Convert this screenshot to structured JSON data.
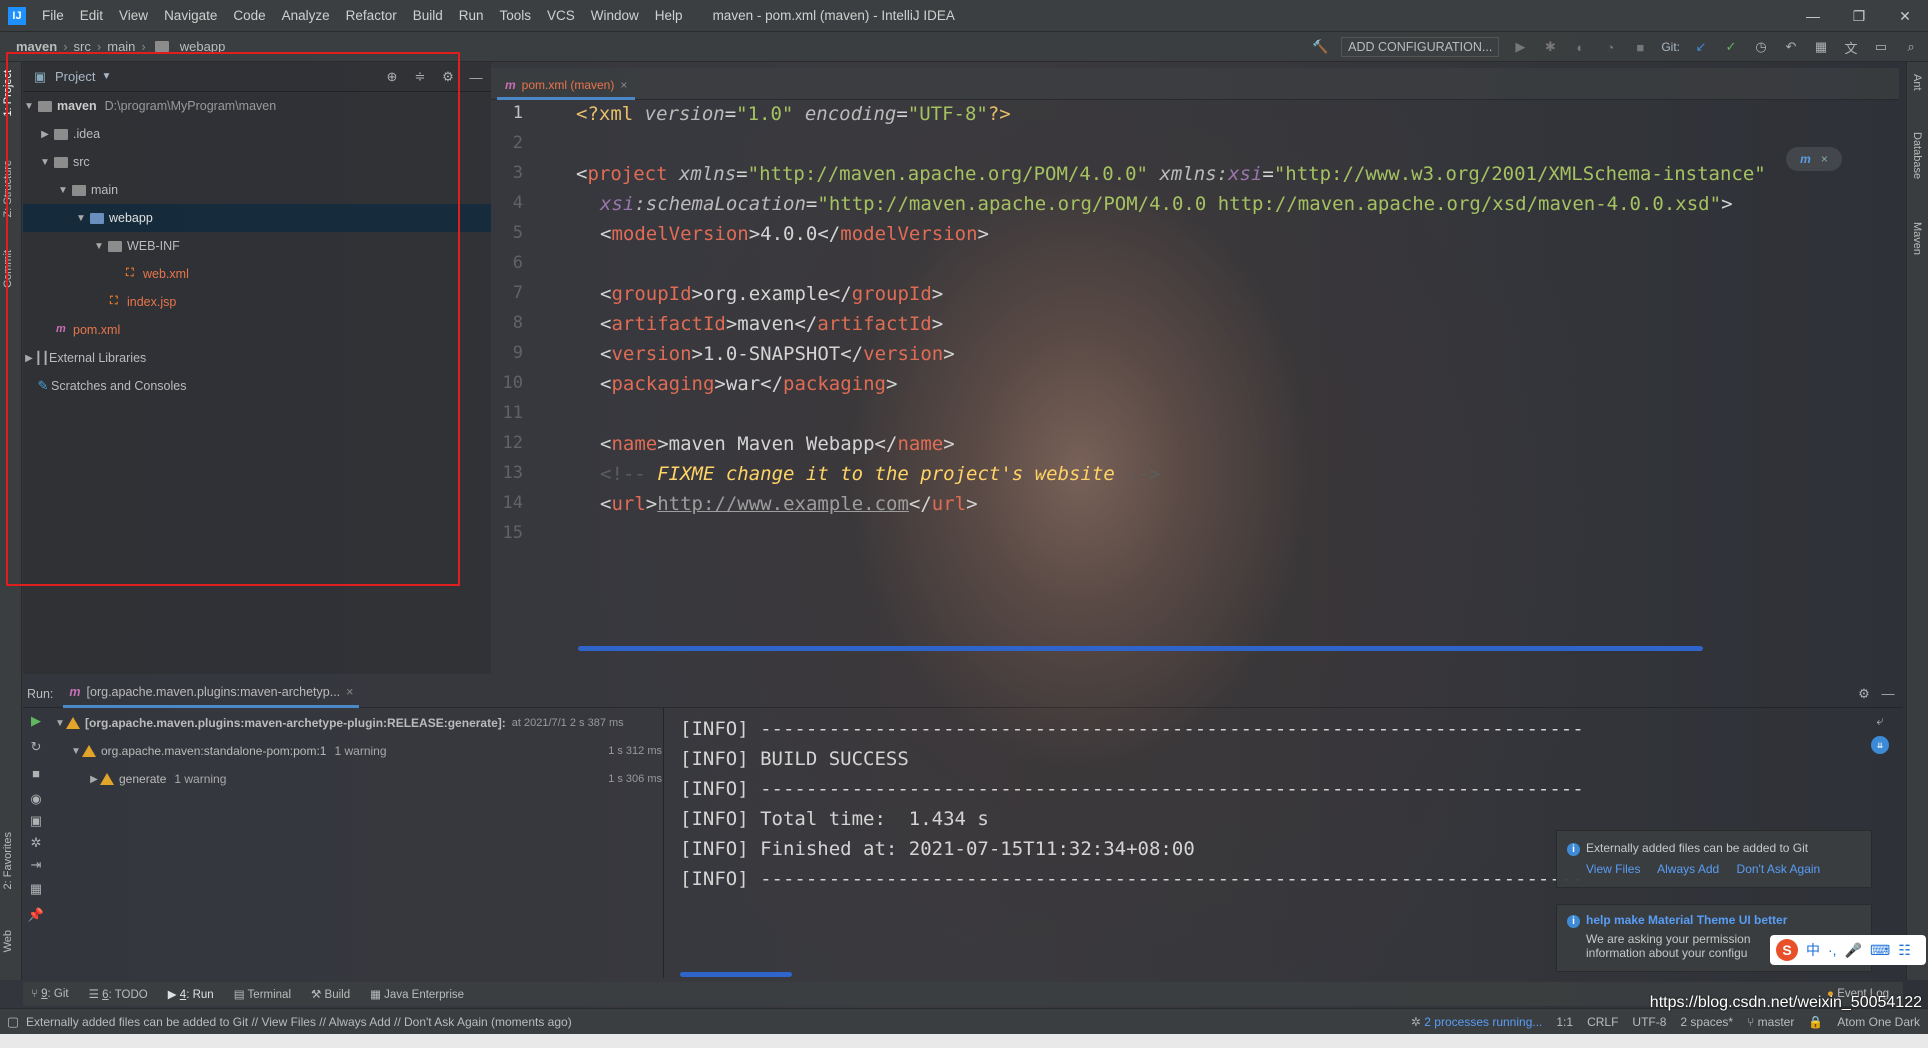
{
  "window": {
    "app_icon": "IJ",
    "menu": [
      "File",
      "Edit",
      "View",
      "Navigate",
      "Code",
      "Analyze",
      "Refactor",
      "Build",
      "Run",
      "Tools",
      "VCS",
      "Window",
      "Help"
    ],
    "title": "maven - pom.xml (maven) - IntelliJ IDEA"
  },
  "breadcrumbs": [
    "maven",
    "src",
    "main",
    "webapp"
  ],
  "toolbar": {
    "add_config": "ADD CONFIGURATION...",
    "git_label": "Git:"
  },
  "left_stripe": {
    "project": "1: Project",
    "structure": "Z: Structure",
    "commit": "Commit",
    "favorites": "2: Favorites",
    "web": "Web"
  },
  "right_stripe": {
    "ant": "Ant",
    "database": "Database",
    "maven": "Maven"
  },
  "project_panel": {
    "title": "Project",
    "tree": [
      {
        "label": "maven",
        "extra": "D:\\program\\MyProgram\\maven"
      },
      {
        "label": ".idea"
      },
      {
        "label": "src"
      },
      {
        "label": "main"
      },
      {
        "label": "webapp"
      },
      {
        "label": "WEB-INF"
      },
      {
        "label": "web.xml"
      },
      {
        "label": "index.jsp"
      },
      {
        "label": "pom.xml"
      },
      {
        "label": "External Libraries"
      },
      {
        "label": "Scratches and Consoles"
      }
    ]
  },
  "editor": {
    "tab": "pom.xml (maven)",
    "line_numbers": [
      "1",
      "2",
      "3",
      "4",
      "5",
      "6",
      "7",
      "8",
      "9",
      "10",
      "11",
      "12",
      "13",
      "14",
      "15"
    ],
    "lines": {
      "l1a": "<?xml ",
      "l1b": "version",
      "l1c": "=",
      "l1d": "\"1.0\"",
      "l1e": " encoding",
      "l1f": "=",
      "l1g": "\"UTF-8\"",
      "l1h": "?>",
      "l3a": "<",
      "l3b": "project ",
      "l3c": "xmlns",
      "l3d": "=",
      "l3e": "\"http://maven.apache.org/POM/4.0.0\"",
      "l3f": " xmlns:",
      "l3g": "xsi",
      "l3h": "=",
      "l3i": "\"http://www.w3.org/2001/XMLSchema-instance\"",
      "l4a": "xsi",
      "l4b": ":schemaLocation",
      "l4c": "=",
      "l4d": "\"http://maven.apache.org/POM/4.0.0 http://maven.apache.org/xsd/maven-4.0.0.xsd\"",
      "l4e": ">",
      "l5a": "<",
      "l5b": "modelVersion",
      "l5c": ">4.0.0</",
      "l5d": "modelVersion",
      "l5e": ">",
      "l7a": "<",
      "l7b": "groupId",
      "l7c": ">org.example</",
      "l7d": "groupId",
      "l7e": ">",
      "l8a": "<",
      "l8b": "artifactId",
      "l8c": ">maven</",
      "l8d": "artifactId",
      "l8e": ">",
      "l9a": "<",
      "l9b": "version",
      "l9c": ">1.0-SNAPSHOT</",
      "l9d": "version",
      "l9e": ">",
      "l10a": "<",
      "l10b": "packaging",
      "l10c": ">war</",
      "l10d": "packaging",
      "l10e": ">",
      "l12a": "<",
      "l12b": "name",
      "l12c": ">maven Maven Webapp</",
      "l12d": "name",
      "l12e": ">",
      "l13a": "<!-- ",
      "l13b": "FIXME change it to the project's website",
      "l13c": " -->",
      "l14a": "<",
      "l14b": "url",
      "l14c": ">",
      "l14d": "http://www.example.com",
      "l14e": "</",
      "l14f": "url",
      "l14g": ">"
    }
  },
  "run_panel": {
    "label": "Run:",
    "tab": "[org.apache.maven.plugins:maven-archetyp...",
    "tree": [
      {
        "label": "[org.apache.maven.plugins:maven-archetype-plugin:RELEASE:generate]:",
        "extra": "at 2021/7/1 2 s 387 ms"
      },
      {
        "label": "org.apache.maven:standalone-pom:pom:1",
        "extra": "1 warning",
        "time": "1 s 312 ms"
      },
      {
        "label": "generate",
        "extra": "1 warning",
        "time": "1 s 306 ms"
      }
    ],
    "console": [
      "[INFO] ------------------------------------------------------------------------",
      "[INFO] BUILD SUCCESS",
      "[INFO] ------------------------------------------------------------------------",
      "[INFO] Total time:  1.434 s",
      "[INFO] Finished at: 2021-07-15T11:32:34+08:00",
      "[INFO] ------------------------------------------------------------------------"
    ]
  },
  "notifications": [
    {
      "title": "Externally added files can be added to Git",
      "links": [
        "View Files",
        "Always Add",
        "Don't Ask Again"
      ]
    },
    {
      "title": "help make Material Theme UI better",
      "body1": "We are asking your permission",
      "body2": "information about your configu"
    }
  ],
  "tool_windows": [
    {
      "num": "9",
      "label": ": Git"
    },
    {
      "num": "6",
      "label": ": TODO"
    },
    {
      "num": "4",
      "label": ": Run"
    },
    {
      "num": "",
      "label": "Terminal"
    },
    {
      "num": "",
      "label": "Build"
    },
    {
      "num": "",
      "label": "Java Enterprise"
    }
  ],
  "event_log": "Event Log",
  "status": {
    "message": "Externally added files can be added to Git // View Files // Always Add // Don't Ask Again (moments ago)",
    "processes": "2 processes running...",
    "position": "1:1",
    "line_sep": "CRLF",
    "encoding": "UTF-8",
    "indent": "2 spaces*",
    "branch": "master",
    "theme": "Atom One Dark"
  },
  "watermark": "https://blog.csdn.net/weixin_50054122",
  "ime": [
    "中",
    "·,",
    "🎤",
    "⌨",
    "☷"
  ],
  "colors": {
    "accent": "#4a88c7",
    "selection": "#0d293e",
    "highlight_box": "#e01e1e",
    "scroll": "#2f65ca"
  }
}
